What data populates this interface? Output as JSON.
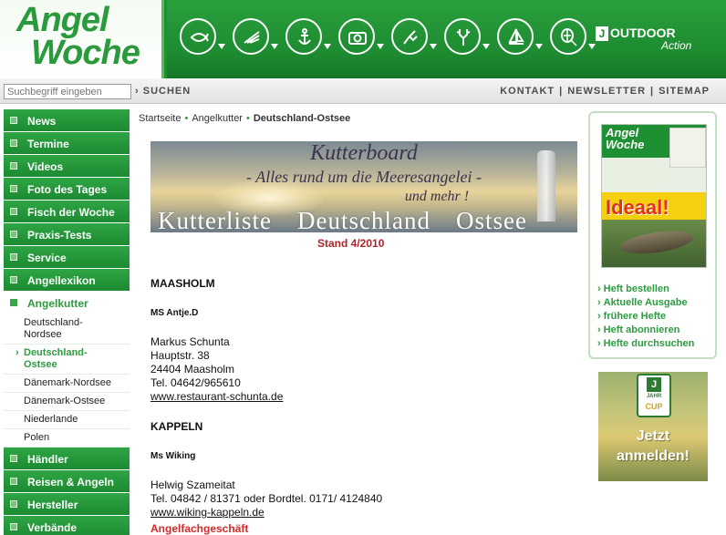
{
  "header": {
    "logo_line1": "Angel",
    "logo_line2": "Woche",
    "nav_icons": [
      {
        "name": "fishing-icon"
      },
      {
        "name": "fly-fishing-icon"
      },
      {
        "name": "anchor-icon"
      },
      {
        "name": "camera-icon"
      },
      {
        "name": "hunting-icon"
      },
      {
        "name": "deer-icon"
      },
      {
        "name": "sailing-icon"
      },
      {
        "name": "tennis-icon"
      }
    ],
    "outdoor_j": "J",
    "outdoor_label": "OUTDOOR",
    "outdoor_sub": "Action"
  },
  "search": {
    "placeholder": "Suchbegriff eingeben",
    "button_label": "SUCHEN"
  },
  "top_links": [
    "KONTAKT",
    "NEWSLETTER",
    "SITEMAP"
  ],
  "sidebar": {
    "items": [
      {
        "label": "News"
      },
      {
        "label": "Termine"
      },
      {
        "label": "Videos"
      },
      {
        "label": "Foto des Tages"
      },
      {
        "label": "Fisch der Woche"
      },
      {
        "label": "Praxis-Tests"
      },
      {
        "label": "Service"
      },
      {
        "label": "Angellexikon"
      }
    ],
    "active_item": "Angelkutter",
    "sub_items": [
      "Deutschland-Nordsee",
      "Deutschland-Ostsee",
      "Dänemark-Nordsee",
      "Dänemark-Ostsee",
      "Niederlande",
      "Polen"
    ],
    "sub_item_lines": [
      [
        "Deutschland-",
        "Nordsee"
      ],
      [
        "Deutschland-",
        "Ostsee"
      ]
    ],
    "current_marker": "›",
    "items_after": [
      {
        "label": "Händler"
      },
      {
        "label": "Reisen & Angeln"
      },
      {
        "label": "Hersteller"
      },
      {
        "label": "Verbände"
      }
    ]
  },
  "breadcrumb": [
    "Startseite",
    "Angelkutter",
    "Deutschland-Ostsee"
  ],
  "banner": {
    "line1": "Kutterboard",
    "line2": "- Alles rund um die Meeresangelei -",
    "line3": "und mehr !",
    "bottom": [
      "Kutterliste",
      "Deutschland",
      "Ostsee"
    ]
  },
  "stand": "Stand 4/2010",
  "entries": [
    {
      "region": "MAASHOLM",
      "ship": "MS Antje.D",
      "lines": [
        "Markus Schunta",
        "Hauptstr. 38",
        "24404 Maasholm",
        "Tel. 04642/965610"
      ],
      "link": "www.restaurant-schunta.de"
    },
    {
      "region": "KAPPELN",
      "ship": "Ms Wiking",
      "lines": [
        "Helwig Szameitat",
        "Tel. 04842 / 81371 oder Bordtel. 0171/ 4124840"
      ],
      "link": "www.wiking-kappeln.de"
    }
  ],
  "section_red": "Angelfachgeschäft",
  "magazine": {
    "cover_logo1": "Angel",
    "cover_logo2": "Woche",
    "cover_headline": "Ideaal!",
    "links": [
      "Heft bestellen",
      "Aktuelle Ausgabe",
      "frühere Hefte",
      "Heft abonnieren",
      "Hefte durchsuchen"
    ]
  },
  "promo": {
    "badge_letter": "J",
    "badge_text": "JAHR",
    "badge_cup": "CUP",
    "cta_line1": "Jetzt",
    "cta_line2": "anmelden!"
  },
  "colors": {
    "brand_green": "#1f8f33",
    "accent_red": "#b0242a",
    "link_green": "#2d9b40"
  }
}
